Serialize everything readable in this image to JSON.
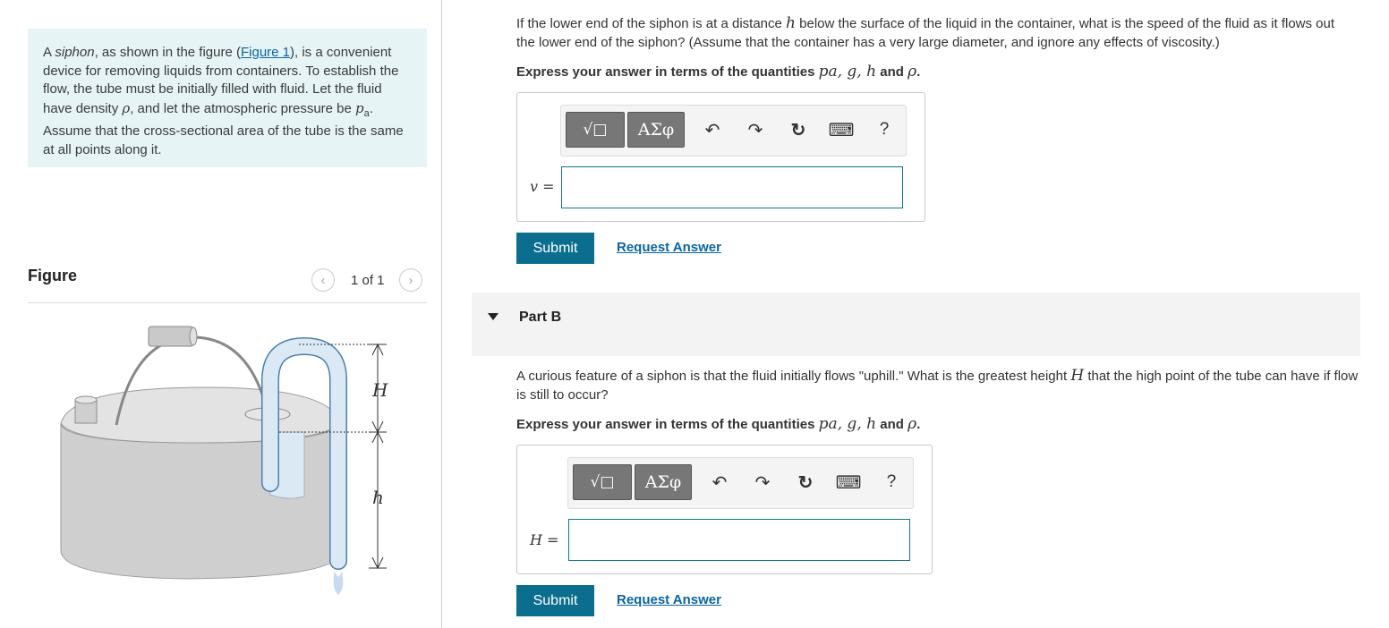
{
  "intro": {
    "s1": "A ",
    "s2": "siphon",
    "s3": ", as shown in the figure (",
    "link": "Figure 1",
    "s4": "), is a convenient device for removing liquids from containers. To establish the flow, the tube must be initially filled with fluid. Let the fluid have density ",
    "rho": "ρ",
    "s5": ", and let the atmospheric pressure be ",
    "pa": "p",
    "pa_sub": "a",
    "s6": ". Assume that the cross-sectional area of the tube is the same at all points along it."
  },
  "figure": {
    "title": "Figure",
    "counter": "1 of 1",
    "prev_icon": "‹",
    "next_icon": "›",
    "label_H": "H",
    "label_h": "h"
  },
  "partA": {
    "q1": "If the lower end of the siphon is at a distance ",
    "q_h": "h",
    "q2": " below the surface of the liquid in the container, what is the speed of the fluid as it flows out the lower end of the siphon? (Assume that the container has a very large diameter, and ignore any effects of viscosity.)",
    "express": "Express your answer in terms of the quantities ",
    "quantities": "pa, g, h",
    "and_text": " and ",
    "rho": "ρ",
    "period": ".",
    "var_label": "v =",
    "input_value": "",
    "submit": "Submit",
    "request": "Request Answer"
  },
  "partB": {
    "label": "Part B",
    "q1": "A curious feature of a siphon is that the fluid initially flows \"uphill.\" What is the greatest height ",
    "q_H": "H",
    "q2": " that the high point of the tube can have if flow is still to occur?",
    "express": "Express your answer in terms of the quantities ",
    "quantities": "pa, g, h",
    "and_text": " and ",
    "rho": "ρ",
    "period": ".",
    "var_label": "H =",
    "input_value": "",
    "submit": "Submit",
    "request": "Request Answer"
  },
  "toolbar": {
    "templates_icon": "√□",
    "greek": "ΑΣφ",
    "undo": "↶",
    "redo": "↷",
    "reset": "↻",
    "keyboard": "⌨",
    "help": "?"
  },
  "colors": {
    "intro_bg": "#e6f4f6",
    "link": "#0a64a8",
    "submit_bg": "#0b6e8e",
    "input_border": "#0e7490",
    "tube_fill": "#dbe9f5",
    "tube_stroke": "#4a7fb0"
  }
}
